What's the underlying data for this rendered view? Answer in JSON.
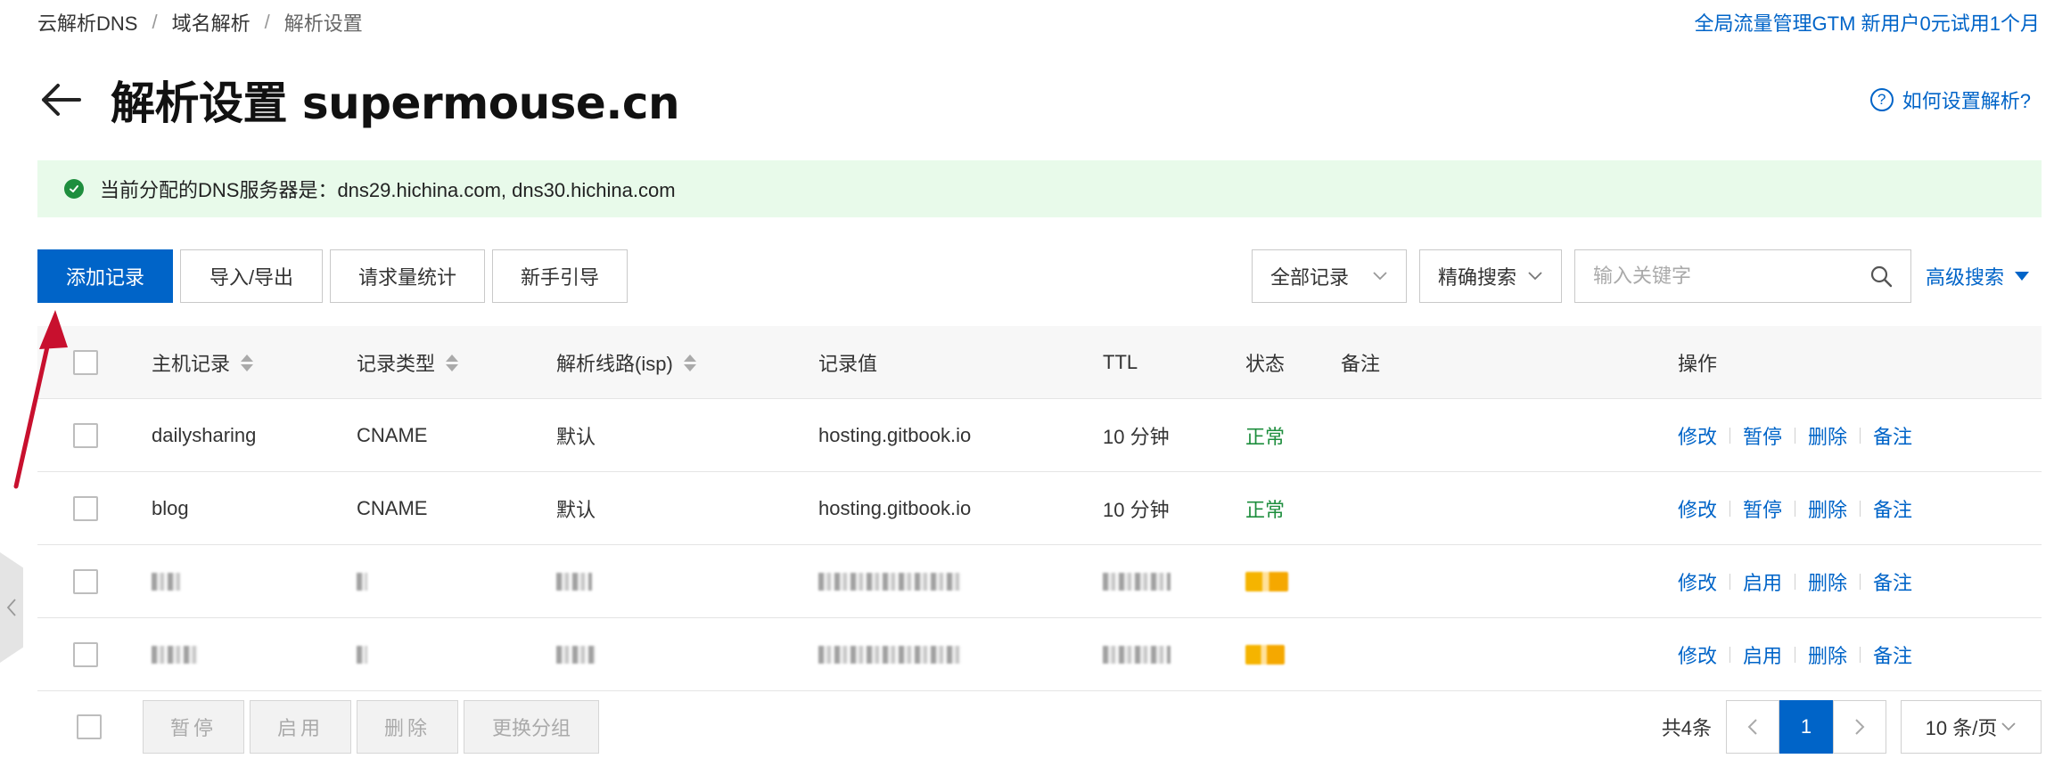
{
  "breadcrumb": {
    "items": [
      "云解析DNS",
      "域名解析",
      "解析设置"
    ],
    "separator": "/"
  },
  "promo": "全局流量管理GTM 新用户0元试用1个月",
  "title": "解析设置 supermouse.cn",
  "help": {
    "label": "如何设置解析?",
    "icon": "question-circle-icon"
  },
  "notice": "当前分配的DNS服务器是：dns29.hichina.com, dns30.hichina.com",
  "toolbar": {
    "add": "添加记录",
    "import_export": "导入/导出",
    "stats": "请求量统计",
    "guide": "新手引导",
    "filter_all": "全部记录",
    "exact_search": "精确搜索",
    "search_placeholder": "输入关键字",
    "advanced": "高级搜索"
  },
  "table": {
    "headers": {
      "host": "主机记录",
      "type": "记录类型",
      "line": "解析线路(isp)",
      "value": "记录值",
      "ttl": "TTL",
      "status": "状态",
      "note": "备注",
      "ops": "操作"
    },
    "rows": [
      {
        "host": "dailysharing",
        "type": "CNAME",
        "line": "默认",
        "value": "hosting.gitbook.io",
        "ttl": "10 分钟",
        "status": "正常",
        "ops": [
          "修改",
          "暂停",
          "删除",
          "备注"
        ]
      },
      {
        "host": "blog",
        "type": "CNAME",
        "line": "默认",
        "value": "hosting.gitbook.io",
        "ttl": "10 分钟",
        "status": "正常",
        "ops": [
          "修改",
          "暂停",
          "删除",
          "备注"
        ]
      },
      {
        "host": "",
        "type": "",
        "line": "",
        "value": "",
        "ttl": "",
        "status": "",
        "ops": [
          "修改",
          "启用",
          "删除",
          "备注"
        ]
      },
      {
        "host": "",
        "type": "",
        "line": "",
        "value": "",
        "ttl": "",
        "status": "",
        "ops": [
          "修改",
          "启用",
          "删除",
          "备注"
        ]
      }
    ]
  },
  "footer": {
    "pause": "暂停",
    "enable": "启用",
    "delete": "删除",
    "change_group": "更换分组",
    "total": "共4条",
    "page": "1",
    "page_size": "10 条/页"
  },
  "colors": {
    "primary": "#0064c8",
    "success": "#1e8e3e",
    "notice_bg": "#e8faea",
    "annotation_arrow": "#c8102e"
  }
}
